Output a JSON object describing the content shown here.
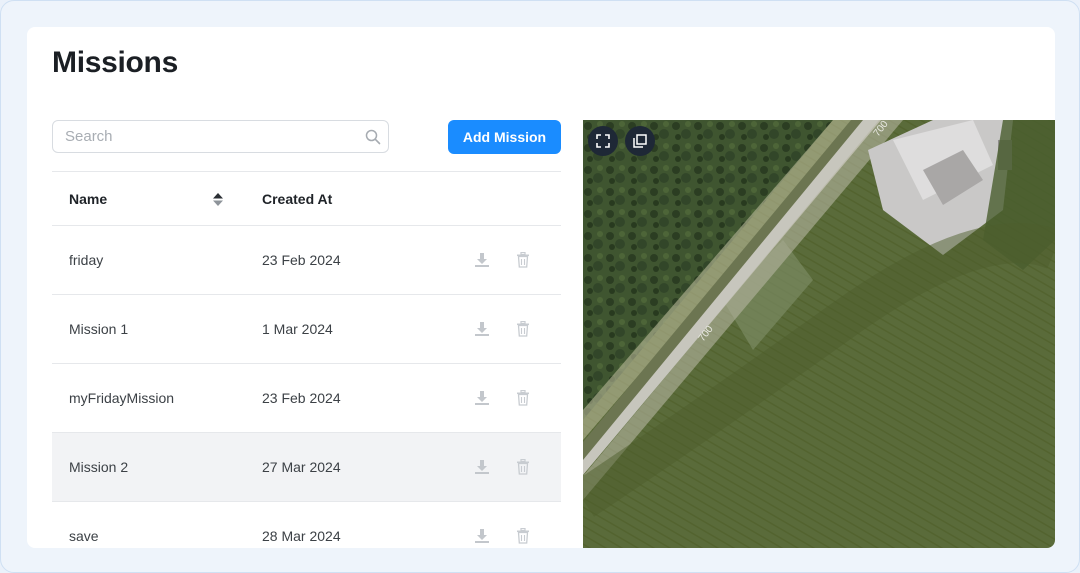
{
  "page": {
    "title": "Missions"
  },
  "search": {
    "placeholder": "Search",
    "value": ""
  },
  "toolbar": {
    "add_mission_label": "Add Mission"
  },
  "table": {
    "columns": {
      "name": "Name",
      "created_at": "Created At"
    },
    "rows": [
      {
        "name": "friday",
        "created_at": "23 Feb 2024"
      },
      {
        "name": "Mission 1",
        "created_at": "1 Mar 2024"
      },
      {
        "name": "myFridayMission",
        "created_at": "23 Feb 2024"
      },
      {
        "name": "Mission 2",
        "created_at": "27 Mar 2024",
        "highlighted": true
      },
      {
        "name": "save",
        "created_at": "28 Mar 2024"
      }
    ]
  },
  "map": {
    "road_label": "700"
  },
  "icons": {
    "search": "search-icon",
    "sort": "sort-icon",
    "download": "download-icon",
    "delete": "trash-icon",
    "fullscreen": "fullscreen-icon",
    "layers": "layers-icon"
  },
  "colors": {
    "accent": "#1a8cff",
    "map_button": "#1e2836",
    "row_highlight": "#f2f3f5"
  }
}
